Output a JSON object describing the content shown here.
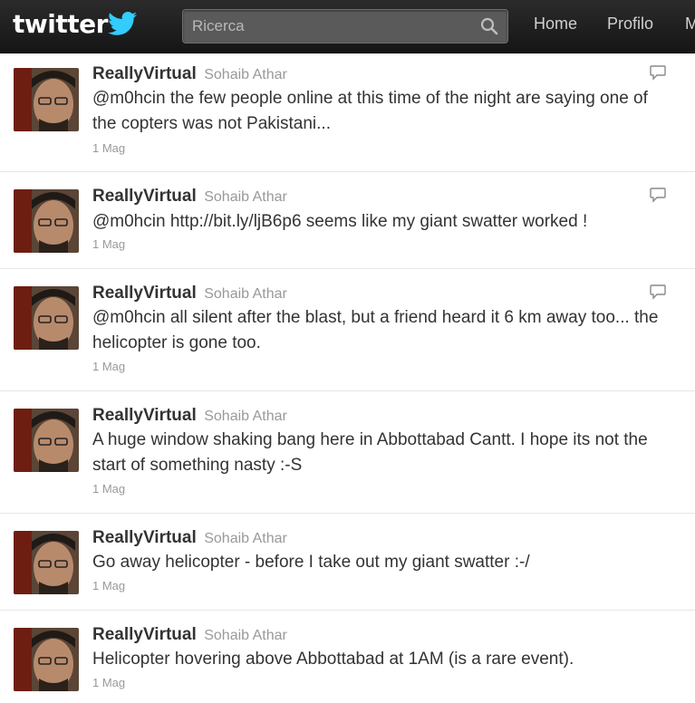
{
  "header": {
    "logo_text": "twitter",
    "search_placeholder": "Ricerca",
    "nav": [
      {
        "label": "Home"
      },
      {
        "label": "Profilo"
      },
      {
        "label": "M"
      }
    ]
  },
  "tweets": [
    {
      "username": "ReallyVirtual",
      "fullname": "Sohaib Athar",
      "text": "@m0hcin the few people online at this time of the night are saying one of the copters was not Pakistani...",
      "time": "1 Mag",
      "show_reply": true
    },
    {
      "username": "ReallyVirtual",
      "fullname": "Sohaib Athar",
      "text": "@m0hcin http://bit.ly/ljB6p6 seems like my giant swatter worked !",
      "time": "1 Mag",
      "show_reply": true
    },
    {
      "username": "ReallyVirtual",
      "fullname": "Sohaib Athar",
      "text": "@m0hcin all silent after the blast, but a friend heard it 6 km away too... the helicopter is gone too.",
      "time": "1 Mag",
      "show_reply": true
    },
    {
      "username": "ReallyVirtual",
      "fullname": "Sohaib Athar",
      "text": "A huge window shaking bang here in Abbottabad Cantt. I hope its not the start of something nasty :-S",
      "time": "1 Mag",
      "show_reply": false
    },
    {
      "username": "ReallyVirtual",
      "fullname": "Sohaib Athar",
      "text": "Go away helicopter - before I take out my giant swatter :-/",
      "time": "1 Mag",
      "show_reply": false
    },
    {
      "username": "ReallyVirtual",
      "fullname": "Sohaib Athar",
      "text": "Helicopter hovering above Abbottabad at 1AM (is a rare event).",
      "time": "1 Mag",
      "show_reply": false
    }
  ],
  "colors": {
    "topbar": "#1f1f1f",
    "username": "#333333",
    "meta": "#999999",
    "bird": "#33ccff"
  }
}
